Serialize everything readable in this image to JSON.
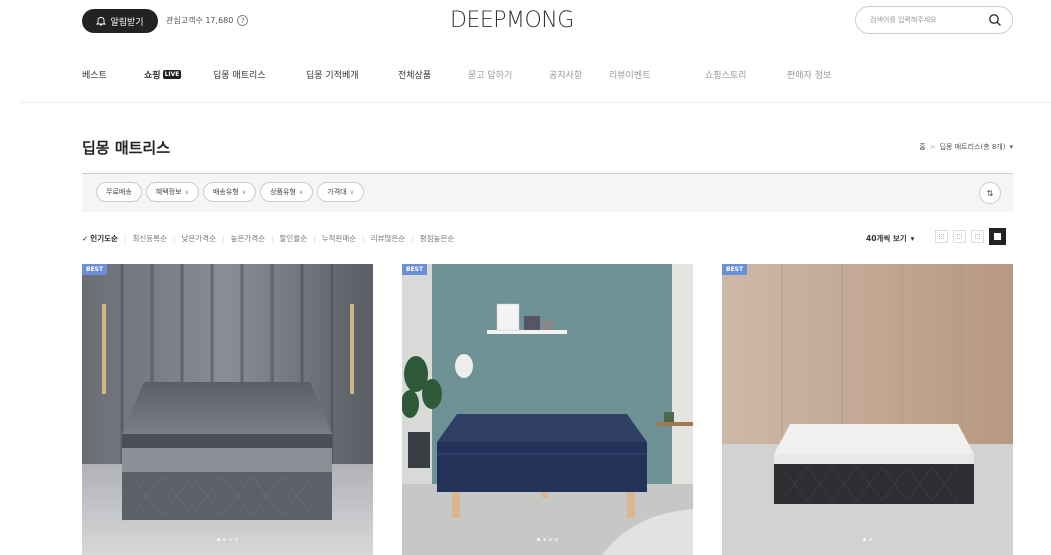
{
  "header": {
    "notify_label": "알림받기",
    "interest_label": "관심고객수 17,680",
    "help_label": "?",
    "logo": "DEEPMONG",
    "search_placeholder": "검색어를 입력해주세요"
  },
  "nav": {
    "items": [
      {
        "label": "베스트"
      },
      {
        "label": "쇼핑"
      },
      {
        "label": "딥몽 매트리스"
      },
      {
        "label": "딥몽 기적베개"
      },
      {
        "label": "전체상품"
      },
      {
        "label": "묻고 답하기"
      },
      {
        "label": "공지사항"
      },
      {
        "label": "리뷰이벤트"
      },
      {
        "label": "쇼핑스토리"
      },
      {
        "label": "판매자 정보"
      }
    ],
    "live_badge": "LIVE"
  },
  "page": {
    "title": "딥몽 매트리스",
    "breadcrumb_home": "홈",
    "breadcrumb_sep": ">",
    "breadcrumb_current": "딥몽 매트리스(총 8개)",
    "breadcrumb_chevron": "▾"
  },
  "filters": {
    "chips": [
      {
        "label": "무료배송",
        "has_dropdown": false
      },
      {
        "label": "혜택정보",
        "has_dropdown": true
      },
      {
        "label": "배송유형",
        "has_dropdown": true
      },
      {
        "label": "상품유형",
        "has_dropdown": true
      },
      {
        "label": "가격대",
        "has_dropdown": true
      }
    ],
    "chevron": "∨",
    "toggle_icon": "⇅"
  },
  "sort": {
    "check": "✓",
    "options": [
      "인기도순",
      "최신등록순",
      "낮은가격순",
      "높은가격순",
      "할인율순",
      "누적판매순",
      "리뷰많은순",
      "평점높은순"
    ],
    "separator": "|",
    "view_count": "40개씩 보기",
    "view_chevron": "▾"
  },
  "products": [
    {
      "badge": "BEST"
    },
    {
      "badge": "BEST"
    },
    {
      "badge": "BEST"
    }
  ],
  "colors": {
    "badge": "#6b8fd6",
    "accent_dark": "#222222"
  }
}
